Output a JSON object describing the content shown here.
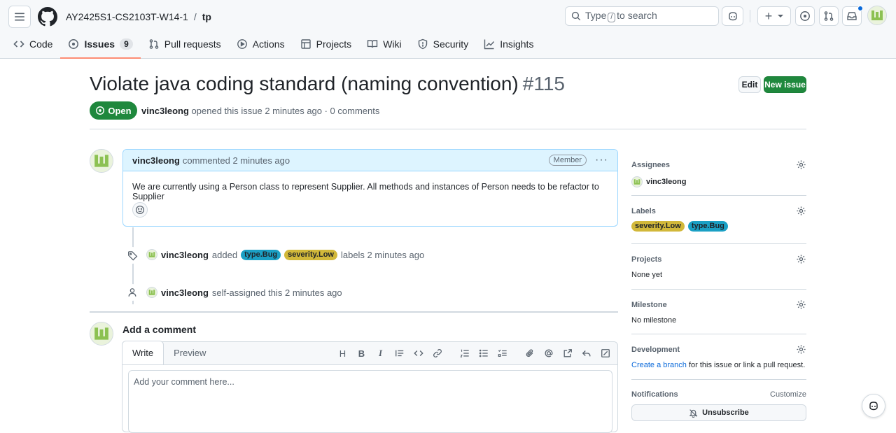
{
  "header": {
    "owner": "AY2425S1-CS2103T-W14-1",
    "separator": "/",
    "repo": "tp",
    "search_placeholder_prefix": "Type",
    "search_key": "/",
    "search_placeholder_suffix": "to search",
    "plus_label": "+"
  },
  "tabs": [
    {
      "label": "Code",
      "icon": "code-icon"
    },
    {
      "label": "Issues",
      "icon": "issue-icon",
      "count": "9"
    },
    {
      "label": "Pull requests",
      "icon": "pull-request-icon"
    },
    {
      "label": "Actions",
      "icon": "play-icon"
    },
    {
      "label": "Projects",
      "icon": "table-icon"
    },
    {
      "label": "Wiki",
      "icon": "book-icon"
    },
    {
      "label": "Security",
      "icon": "shield-icon"
    },
    {
      "label": "Insights",
      "icon": "graph-icon"
    }
  ],
  "issue": {
    "title": "Violate java coding standard (naming convention)",
    "number": "#115",
    "edit_label": "Edit",
    "new_issue_label": "New issue",
    "state": "Open",
    "author": "vinc3leong",
    "meta_text": "opened this issue 2 minutes ago · 0 comments"
  },
  "comment": {
    "author": "vinc3leong",
    "time": "commented 2 minutes ago",
    "badge": "Member",
    "menu": "···",
    "body": "We are currently using a Person class to represent Supplier. All methods and instances of Person needs to be refactor to Supplier"
  },
  "timeline": {
    "label_event": {
      "author": "vinc3leong",
      "action": "added",
      "labels": [
        "type.Bug",
        "severity.Low"
      ],
      "suffix": "labels 2 minutes ago"
    },
    "assign_event": {
      "author": "vinc3leong",
      "text": "self-assigned this 2 minutes ago"
    }
  },
  "add_comment": {
    "heading": "Add a comment",
    "write_tab": "Write",
    "preview_tab": "Preview",
    "placeholder": "Add your comment here...",
    "tool_heading": "H",
    "tool_bold": "B",
    "tool_italic": "I"
  },
  "sidebar": {
    "assignees": {
      "title": "Assignees",
      "value": "vinc3leong"
    },
    "labels": {
      "title": "Labels",
      "items": [
        "severity.Low",
        "type.Bug"
      ]
    },
    "projects": {
      "title": "Projects",
      "value": "None yet"
    },
    "milestone": {
      "title": "Milestone",
      "value": "No milestone"
    },
    "development": {
      "title": "Development",
      "link": "Create a branch",
      "text": "for this issue or link a pull request."
    },
    "notifications": {
      "title": "Notifications",
      "customize": "Customize",
      "unsubscribe": "Unsubscribe"
    }
  },
  "colors": {
    "label_bug": "#1ba0c4",
    "label_low": "#d2b83a",
    "open_green": "#1f883d",
    "accent_blue": "#0969da",
    "tab_underline": "#fd8c73"
  }
}
